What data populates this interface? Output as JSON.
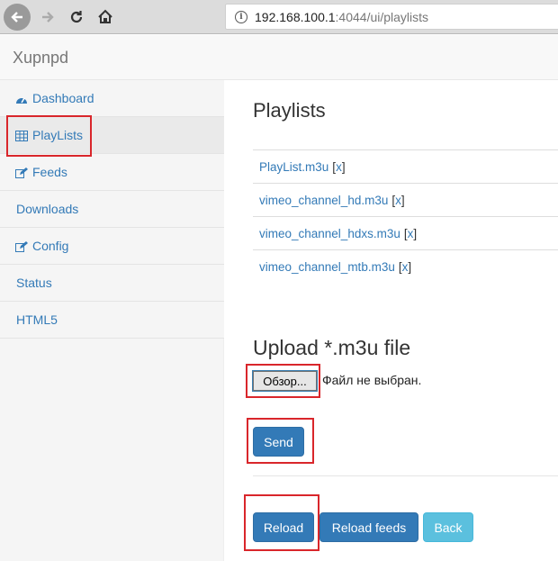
{
  "browser": {
    "url_host": "192.168.100.1",
    "url_rest": ":4044/ui/playlists",
    "back_icon": "arrow-left-icon",
    "forward_icon": "arrow-right-icon",
    "reload_icon": "reload-icon",
    "home_icon": "home-icon",
    "info_icon": "info-icon",
    "info_glyph": "i"
  },
  "navbar": {
    "brand": "Xupnpd"
  },
  "sidebar": {
    "items": [
      {
        "label": "Dashboard",
        "icon": "dashboard-icon"
      },
      {
        "label": "PlayLists",
        "icon": "table-icon",
        "active": true
      },
      {
        "label": "Feeds",
        "icon": "edit-icon"
      },
      {
        "label": "Downloads",
        "icon": ""
      },
      {
        "label": "Config",
        "icon": "edit-icon"
      },
      {
        "label": "Status",
        "icon": ""
      },
      {
        "label": "HTML5",
        "icon": ""
      }
    ]
  },
  "main": {
    "title": "Playlists",
    "playlists": [
      {
        "name": "PlayList.m3u",
        "delete": "x"
      },
      {
        "name": "vimeo_channel_hd.m3u",
        "delete": "x"
      },
      {
        "name": "vimeo_channel_hdxs.m3u",
        "delete": "x"
      },
      {
        "name": "vimeo_channel_mtb.m3u",
        "delete": "x"
      }
    ],
    "upload_title": "Upload *.m3u file",
    "file_button": "Обзор...",
    "file_status": "Файл не выбран.",
    "send_label": "Send",
    "reload_label": "Reload",
    "reload_feeds_label": "Reload feeds",
    "back_label": "Back"
  },
  "colors": {
    "link": "#337ab7",
    "primary": "#337ab7",
    "info": "#5bc0de",
    "highlight": "#d9262b"
  }
}
